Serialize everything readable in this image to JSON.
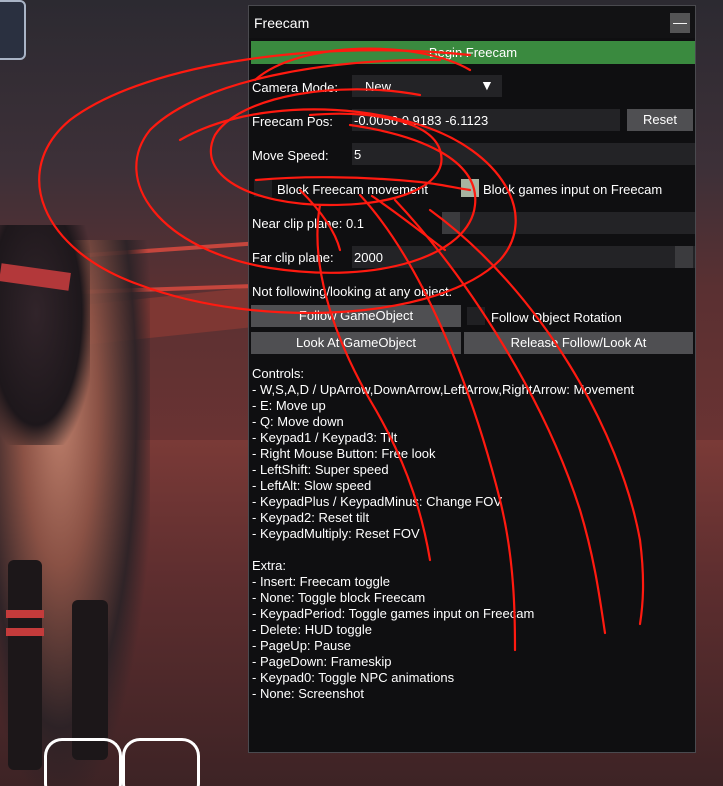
{
  "window": {
    "title": "Freecam",
    "collapse_glyph": "—",
    "begin_label": "Begin Freecam"
  },
  "camera_mode": {
    "label": "Camera Mode:",
    "value": "New",
    "arrow": "▼"
  },
  "freecam_pos": {
    "label": "Freecam Pos:",
    "value": "-0.0056 0.9183 -6.1123",
    "reset_label": "Reset"
  },
  "move_speed": {
    "label": "Move Speed:",
    "value": "5"
  },
  "block_freecam_movement": {
    "label": "Block Freecam movement",
    "checked": false
  },
  "block_games_input": {
    "label": "Block games input on Freecam",
    "checked": true
  },
  "near_clip": {
    "label": "Near clip plane: 0.1"
  },
  "far_clip": {
    "label": "Far clip plane:",
    "value": "2000"
  },
  "follow_status": "Not following/looking at any object.",
  "follow_gameobject_label": "Follow GameObject",
  "follow_rotation": {
    "label": "Follow Object Rotation",
    "checked": false
  },
  "look_at_label": "Look At GameObject",
  "release_label": "Release Follow/Look At",
  "controls": [
    "Controls:",
    "- W,S,A,D / UpArrow,DownArrow,LeftArrow,RightArrow: Movement",
    "- E: Move up",
    "- Q: Move down",
    "- Keypad1 / Keypad3: Tilt",
    "- Right Mouse Button: Free look",
    "- LeftShift: Super speed",
    "- LeftAlt: Slow speed",
    "- KeypadPlus / KeypadMinus: Change FOV",
    "- Keypad2: Reset tilt",
    "- KeypadMultiply: Reset FOV"
  ],
  "extra": [
    "Extra:",
    "- Insert: Freecam toggle",
    "- None: Toggle block Freecam",
    "- KeypadPeriod: Toggle games input on Freecam",
    "- Delete: HUD toggle",
    "- PageUp: Pause",
    "- PageDown: Frameskip",
    "- Keypad0: Toggle NPC animations",
    "- None: Screenshot"
  ],
  "colors": {
    "accent_green": "#3a8a3f",
    "panel_bg": "#0f0f11",
    "ink_red": "#ff1a10"
  }
}
